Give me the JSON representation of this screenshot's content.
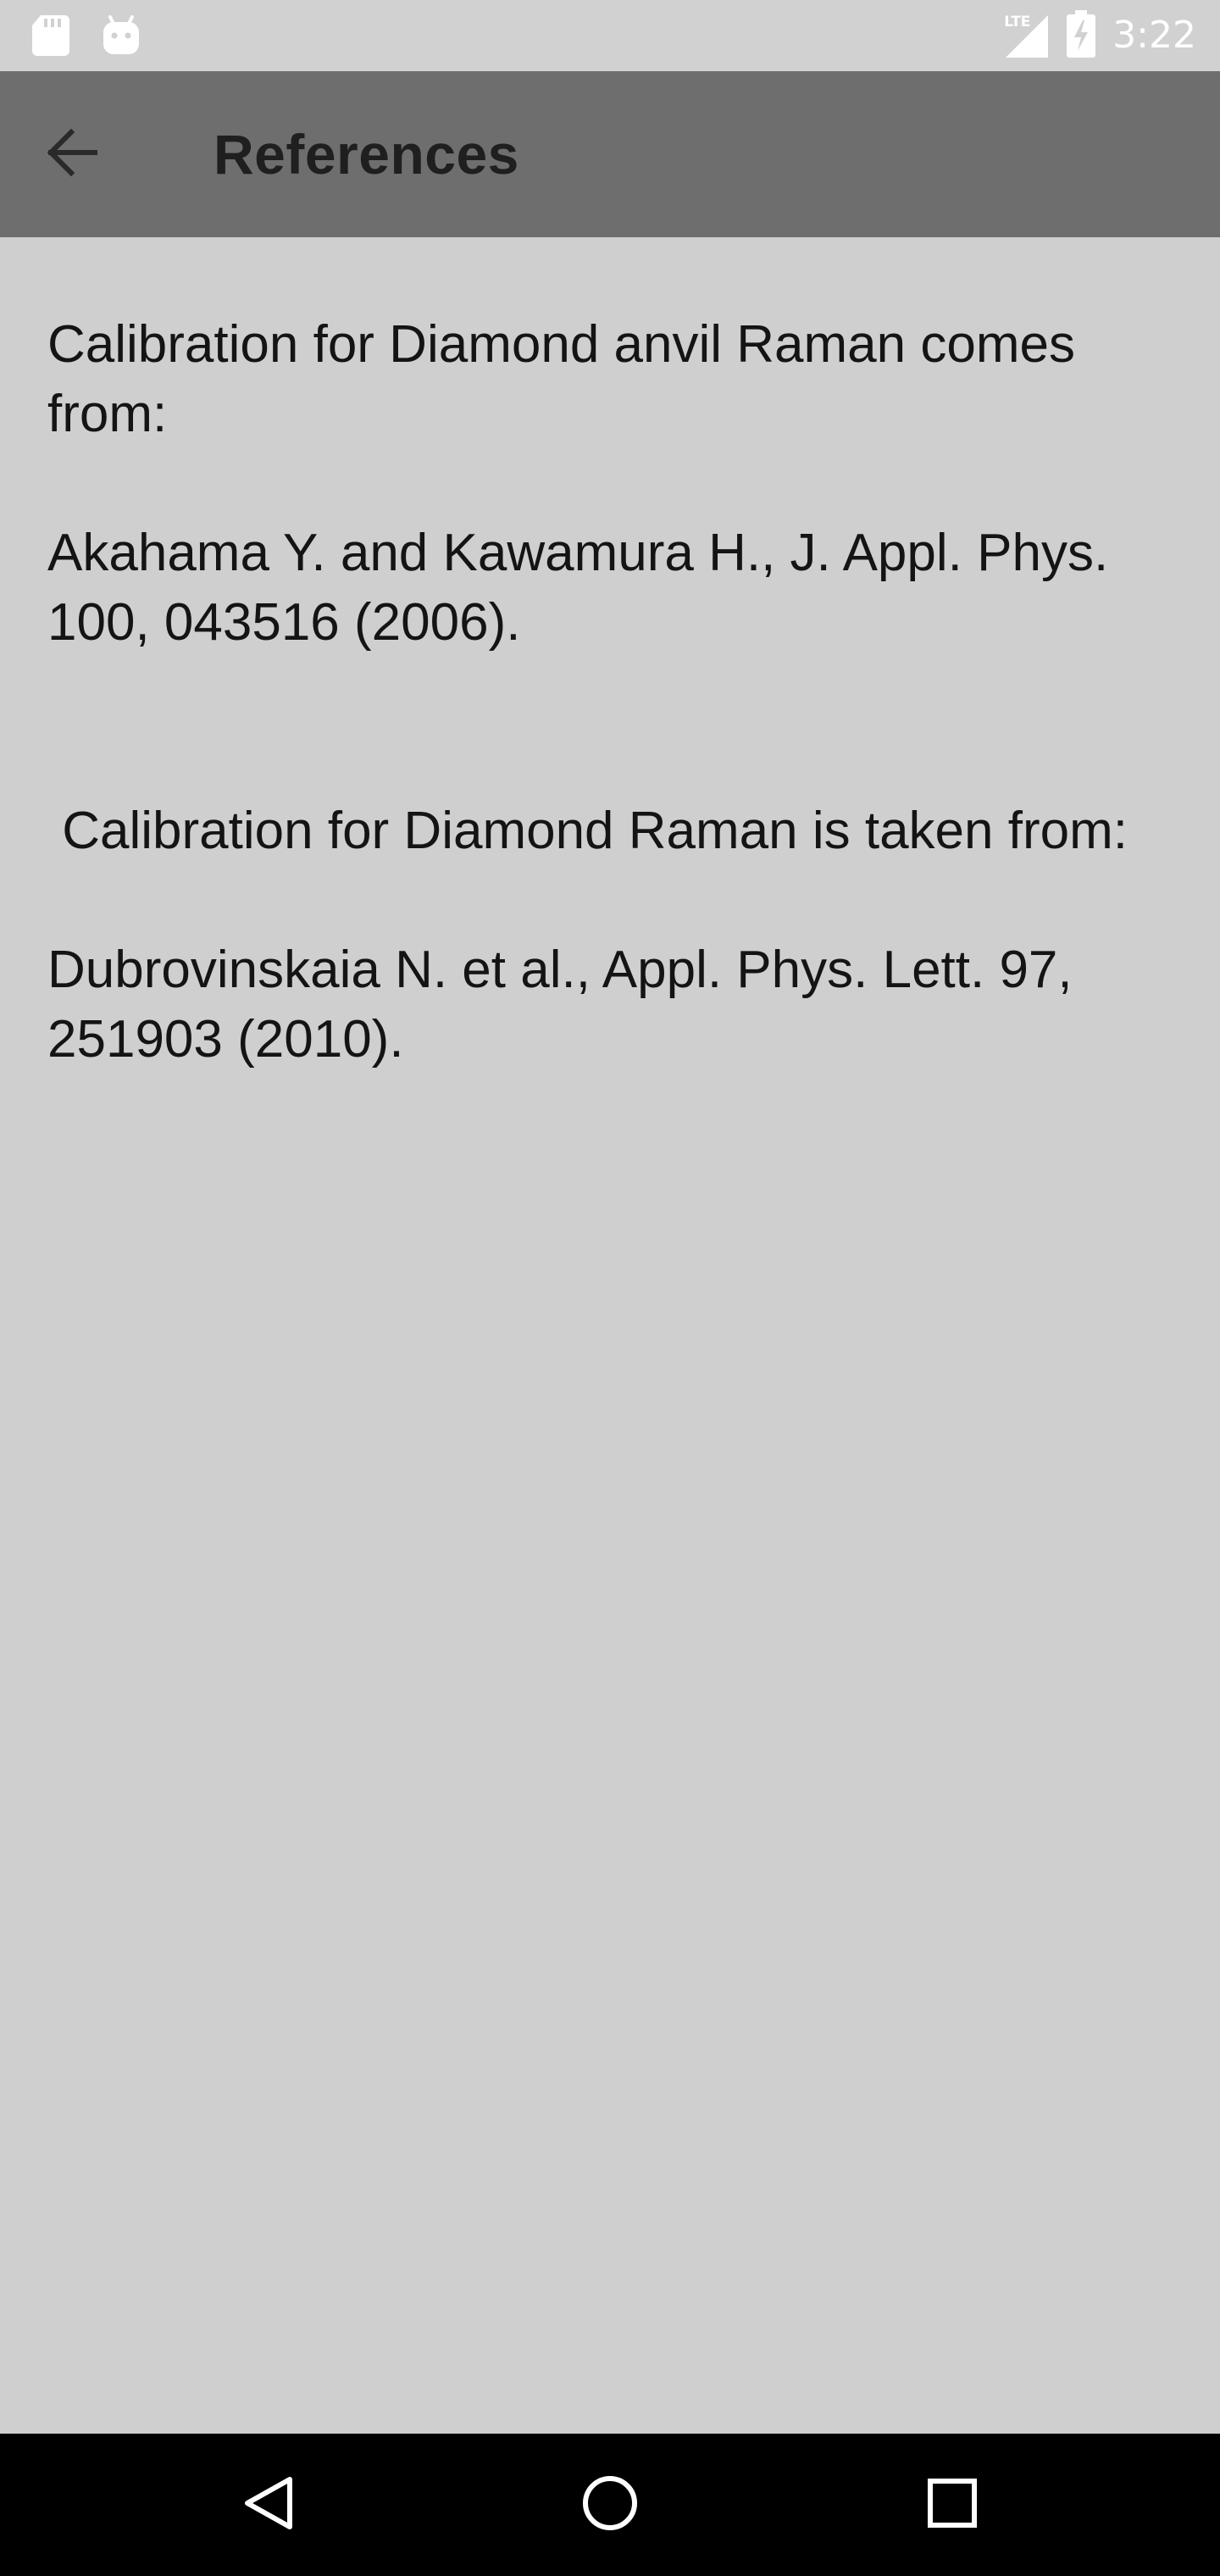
{
  "status_bar": {
    "time": "3:22",
    "network_label": "LTE",
    "icons": [
      "sd-card-icon",
      "android-icon",
      "lte-signal-icon",
      "battery-charging-icon"
    ]
  },
  "app_bar": {
    "title": "References",
    "back_icon": "arrow-back-icon"
  },
  "content": {
    "paragraphs": [
      "Calibration for Diamond anvil Raman comes from:",
      "Akahama Y. and Kawamura H., J. Appl. Phys. 100, 043516 (2006).",
      " Calibration for Diamond Raman is taken from:",
      "Dubrovinskaia N. et al., Appl. Phys. Lett. 97, 251903 (2010)."
    ]
  },
  "nav_bar": {
    "icons": [
      "nav-back-icon",
      "nav-home-icon",
      "nav-recents-icon"
    ]
  },
  "colors": {
    "background": "#cfcfcf",
    "app_bar": "#6e6e6e",
    "status_bar": "#d1d1d1",
    "nav_bar": "#000000",
    "text": "#141414"
  }
}
